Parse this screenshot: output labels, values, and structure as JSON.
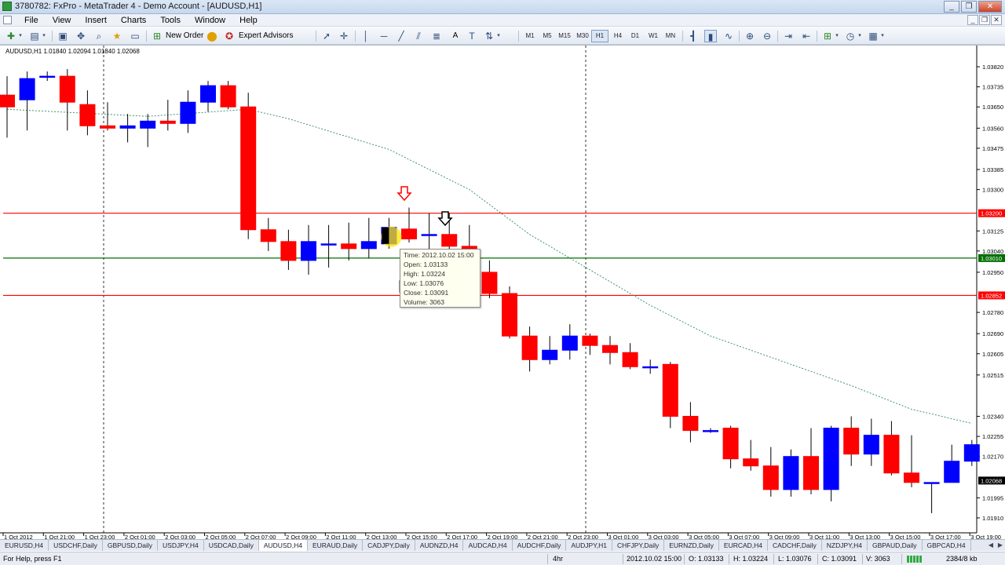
{
  "window": {
    "title": "3780782: FxPro - MetaTrader 4 - Demo Account - [AUDUSD,H1]",
    "controls": [
      "_",
      "❐",
      "✕"
    ]
  },
  "menu": {
    "items": [
      "File",
      "View",
      "Insert",
      "Charts",
      "Tools",
      "Window",
      "Help"
    ],
    "mdi_controls": [
      "_",
      "❐",
      "✕"
    ]
  },
  "toolbar": {
    "new_order_label": "New Order",
    "expert_advisors_label": "Expert Advisors",
    "timeframes": [
      "M1",
      "M5",
      "M15",
      "M30",
      "H1",
      "H4",
      "D1",
      "W1",
      "MN"
    ],
    "active_timeframe": "H1",
    "text_tool_label": "A"
  },
  "chart": {
    "symbol_info": "AUDUSD,H1  1.01840 1.02094 1.01840 1.02068",
    "price_axis_labels": [
      "1.03820",
      "1.03735",
      "1.03650",
      "1.03560",
      "1.03475",
      "1.03385",
      "1.03300",
      "1.03125",
      "1.03040",
      "1.02950",
      "1.02780",
      "1.02690",
      "1.02605",
      "1.02515",
      "1.02340",
      "1.02255",
      "1.02170",
      "1.01995",
      "1.01910"
    ],
    "price_tags": [
      {
        "label": "1.03200",
        "color": "#ff0000"
      },
      {
        "label": "1.03010",
        "color": "#007000"
      },
      {
        "label": "1.02852",
        "color": "#ff0000"
      },
      {
        "label": "1.02068",
        "color": "#000000"
      }
    ],
    "time_axis_labels": [
      "1 Oct 2012",
      "1 Oct 21:00",
      "1 Oct 23:00",
      "2 Oct 01:00",
      "2 Oct 03:00",
      "2 Oct 05:00",
      "2 Oct 07:00",
      "2 Oct 09:00",
      "2 Oct 11:00",
      "2 Oct 13:00",
      "2 Oct 15:00",
      "2 Oct 17:00",
      "2 Oct 19:00",
      "2 Oct 21:00",
      "2 Oct 23:00",
      "3 Oct 01:00",
      "3 Oct 03:00",
      "3 Oct 05:00",
      "3 Oct 07:00",
      "3 Oct 09:00",
      "3 Oct 11:00",
      "3 Oct 13:00",
      "3 Oct 15:00",
      "3 Oct 17:00",
      "3 Oct 19:00"
    ],
    "colors": {
      "bull": "#0000ff",
      "bear": "#ff0000",
      "resistance": "#ff0000",
      "support": "#007000",
      "ma": "#2e8b57"
    },
    "tooltip": {
      "time": "Time: 2012.10.02 15:00",
      "open": "Open: 1.03133",
      "high": "High: 1.03224",
      "low": "Low: 1.03076",
      "close": "Close: 1.03091",
      "volume": "Volume: 3063"
    }
  },
  "chart_data": {
    "type": "candlestick",
    "symbol": "AUDUSD",
    "timeframe": "H1",
    "ylim": [
      1.0187,
      1.0389
    ],
    "horizontal_lines": [
      1.032,
      1.0301,
      1.02852
    ],
    "candles": [
      {
        "o": 1.037,
        "h": 1.0378,
        "l": 1.0352,
        "c": 1.0365
      },
      {
        "o": 1.0368,
        "h": 1.038,
        "l": 1.0355,
        "c": 1.0377
      },
      {
        "o": 1.0378,
        "h": 1.038,
        "l": 1.0376,
        "c": 1.0378
      },
      {
        "o": 1.0378,
        "h": 1.0381,
        "l": 1.0355,
        "c": 1.0367
      },
      {
        "o": 1.0366,
        "h": 1.0372,
        "l": 1.0353,
        "c": 1.0357
      },
      {
        "o": 1.0357,
        "h": 1.0367,
        "l": 1.0355,
        "c": 1.0356
      },
      {
        "o": 1.0356,
        "h": 1.0362,
        "l": 1.035,
        "c": 1.0357
      },
      {
        "o": 1.0356,
        "h": 1.0362,
        "l": 1.0348,
        "c": 1.0359
      },
      {
        "o": 1.0359,
        "h": 1.0368,
        "l": 1.0355,
        "c": 1.0358
      },
      {
        "o": 1.0358,
        "h": 1.0372,
        "l": 1.0354,
        "c": 1.0367
      },
      {
        "o": 1.0367,
        "h": 1.0376,
        "l": 1.0363,
        "c": 1.0374
      },
      {
        "o": 1.0374,
        "h": 1.0376,
        "l": 1.0364,
        "c": 1.0365
      },
      {
        "o": 1.0365,
        "h": 1.0371,
        "l": 1.0309,
        "c": 1.0313
      },
      {
        "o": 1.0313,
        "h": 1.0318,
        "l": 1.0304,
        "c": 1.0308
      },
      {
        "o": 1.0308,
        "h": 1.0313,
        "l": 1.0296,
        "c": 1.03
      },
      {
        "o": 1.03,
        "h": 1.0315,
        "l": 1.0294,
        "c": 1.0308
      },
      {
        "o": 1.0307,
        "h": 1.0315,
        "l": 1.0297,
        "c": 1.0307
      },
      {
        "o": 1.0307,
        "h": 1.0316,
        "l": 1.03,
        "c": 1.0305
      },
      {
        "o": 1.0305,
        "h": 1.0318,
        "l": 1.0301,
        "c": 1.0308
      },
      {
        "o": 1.0307,
        "h": 1.0318,
        "l": 1.0305,
        "c": 1.0314
      },
      {
        "o": 1.03133,
        "h": 1.03224,
        "l": 1.03076,
        "c": 1.03091
      },
      {
        "o": 1.0311,
        "h": 1.032,
        "l": 1.0303,
        "c": 1.0311
      },
      {
        "o": 1.0311,
        "h": 1.032,
        "l": 1.0302,
        "c": 1.0306
      },
      {
        "o": 1.0306,
        "h": 1.0315,
        "l": 1.029,
        "c": 1.029
      },
      {
        "o": 1.0295,
        "h": 1.03,
        "l": 1.0284,
        "c": 1.0286
      },
      {
        "o": 1.0286,
        "h": 1.0289,
        "l": 1.0267,
        "c": 1.0268
      },
      {
        "o": 1.0268,
        "h": 1.0272,
        "l": 1.0253,
        "c": 1.0258
      },
      {
        "o": 1.0258,
        "h": 1.0268,
        "l": 1.0256,
        "c": 1.0262
      },
      {
        "o": 1.0262,
        "h": 1.0273,
        "l": 1.0258,
        "c": 1.0268
      },
      {
        "o": 1.0268,
        "h": 1.0269,
        "l": 1.026,
        "c": 1.0264
      },
      {
        "o": 1.0264,
        "h": 1.0268,
        "l": 1.0256,
        "c": 1.0261
      },
      {
        "o": 1.0261,
        "h": 1.0265,
        "l": 1.0254,
        "c": 1.0255
      },
      {
        "o": 1.0255,
        "h": 1.0258,
        "l": 1.0252,
        "c": 1.0255
      },
      {
        "o": 1.0256,
        "h": 1.0257,
        "l": 1.0229,
        "c": 1.0234
      },
      {
        "o": 1.0234,
        "h": 1.024,
        "l": 1.0223,
        "c": 1.0228
      },
      {
        "o": 1.0228,
        "h": 1.0229,
        "l": 1.0227,
        "c": 1.0228
      },
      {
        "o": 1.0229,
        "h": 1.023,
        "l": 1.0212,
        "c": 1.0216
      },
      {
        "o": 1.0216,
        "h": 1.0224,
        "l": 1.0211,
        "c": 1.0213
      },
      {
        "o": 1.0213,
        "h": 1.0221,
        "l": 1.02,
        "c": 1.0203
      },
      {
        "o": 1.0203,
        "h": 1.022,
        "l": 1.02,
        "c": 1.0217
      },
      {
        "o": 1.0217,
        "h": 1.0229,
        "l": 1.0201,
        "c": 1.0203
      },
      {
        "o": 1.0203,
        "h": 1.023,
        "l": 1.0198,
        "c": 1.0229
      },
      {
        "o": 1.0229,
        "h": 1.0234,
        "l": 1.0213,
        "c": 1.0218
      },
      {
        "o": 1.0218,
        "h": 1.0233,
        "l": 1.0213,
        "c": 1.0226
      },
      {
        "o": 1.0226,
        "h": 1.0232,
        "l": 1.0209,
        "c": 1.021
      },
      {
        "o": 1.021,
        "h": 1.0226,
        "l": 1.0204,
        "c": 1.0206
      },
      {
        "o": 1.0206,
        "h": 1.0206,
        "l": 1.0193,
        "c": 1.0206
      },
      {
        "o": 1.0206,
        "h": 1.0222,
        "l": 1.0206,
        "c": 1.0215
      },
      {
        "o": 1.0215,
        "h": 1.0224,
        "l": 1.0213,
        "c": 1.0222
      }
    ],
    "moving_average": [
      [
        0,
        1.0364
      ],
      [
        7,
        1.0361
      ],
      [
        12,
        1.0364
      ],
      [
        14,
        1.036
      ],
      [
        19,
        1.0347
      ],
      [
        23,
        1.033
      ],
      [
        26,
        1.0311
      ],
      [
        29,
        1.0296
      ],
      [
        32,
        1.0281
      ],
      [
        35,
        1.0268
      ],
      [
        39,
        1.0256
      ],
      [
        42,
        1.0247
      ],
      [
        45,
        1.0237
      ],
      [
        48,
        1.0231
      ]
    ]
  },
  "symbol_tabs": {
    "items": [
      "EURUSD,H4",
      "USDCHF,Daily",
      "GBPUSD,Daily",
      "USDJPY,H4",
      "USDCAD,Daily",
      "AUDUSD,H4",
      "EURAUD,Daily",
      "CADJPY,Daily",
      "AUDNZD,H4",
      "AUDCAD,H4",
      "AUDCHF,Daily",
      "AUDJPY,H1",
      "CHFJPY,Daily",
      "EURNZD,Daily",
      "EURCAD,H4",
      "CADCHF,Daily",
      "NZDJPY,H4",
      "GBPAUD,Daily",
      "GBPCAD,H4"
    ],
    "active_index": 5,
    "arrows": [
      "◀",
      "▶"
    ]
  },
  "status": {
    "help": "For Help, press F1",
    "profile": "4hr",
    "time": "2012.10.02 15:00",
    "open": "O: 1.03133",
    "high": "H: 1.03224",
    "low": "L: 1.03076",
    "close": "C: 1.03091",
    "volume": "V: 3063",
    "traffic": "2384/8 kb"
  }
}
